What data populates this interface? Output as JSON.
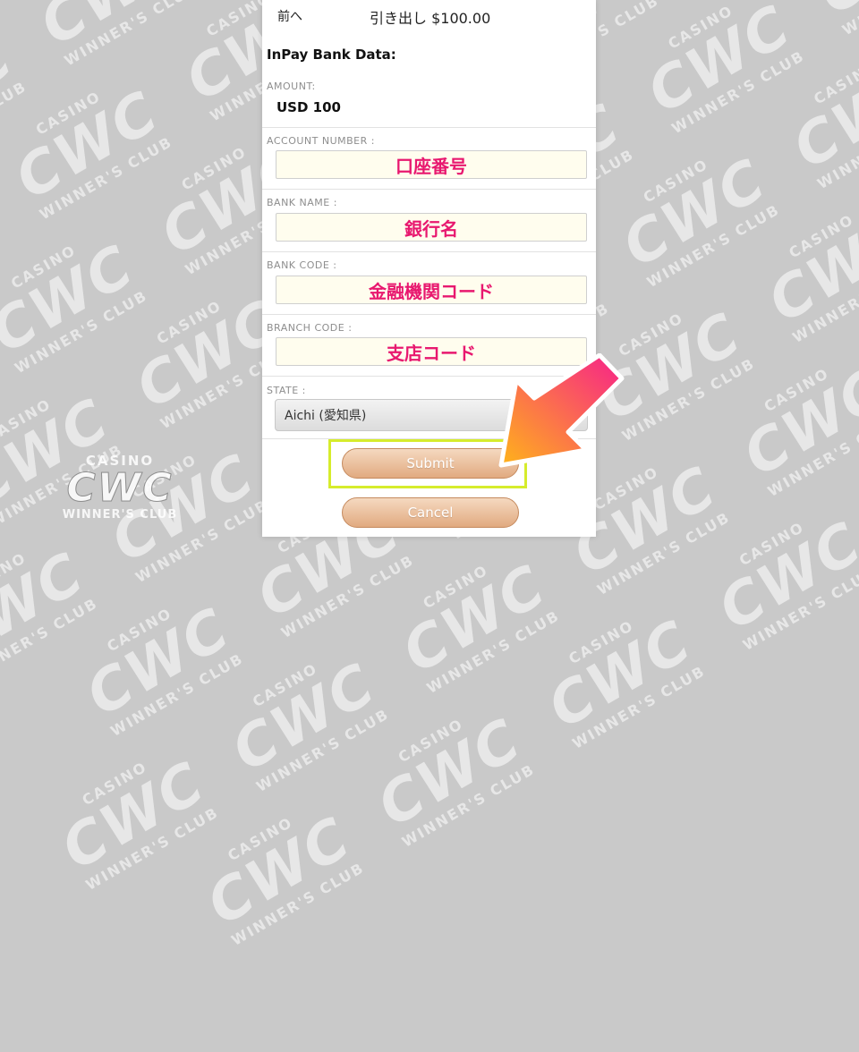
{
  "watermark": {
    "casino": "CASINO",
    "cwc": "CWC",
    "club": "WINNER'S CLUB"
  },
  "header": {
    "back_label": "前へ",
    "title": "引き出し $100.00"
  },
  "section_title": "InPay Bank Data:",
  "amount": {
    "label": "AMOUNT:",
    "value": "USD 100"
  },
  "fields": {
    "account_number": {
      "label": "ACCOUNT NUMBER :",
      "value": "口座番号"
    },
    "bank_name": {
      "label": "BANK NAME :",
      "value": "銀行名"
    },
    "bank_code": {
      "label": "BANK CODE :",
      "value": "金融機関コード"
    },
    "branch_code": {
      "label": "BRANCH CODE :",
      "value": "支店コード"
    }
  },
  "state": {
    "label": "STATE :",
    "selected": "Aichi (愛知県)"
  },
  "buttons": {
    "submit": "Submit",
    "cancel": "Cancel"
  },
  "colors": {
    "input_text": "#e8186f",
    "highlight_border": "#d6ec2c",
    "arrow_gradient_start": "#f7218a",
    "arrow_gradient_end": "#ffb31a"
  }
}
